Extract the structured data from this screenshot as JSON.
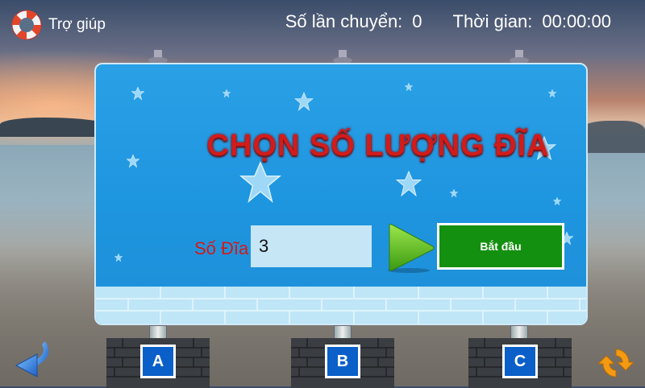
{
  "header": {
    "help_label": "Trợ giúp",
    "moves_label": "Số lần chuyển:",
    "moves_value": "0",
    "time_label": "Thời gian:",
    "time_value": "00:00:00"
  },
  "board": {
    "title": "CHỌN SỐ LƯỢNG ĐĨA",
    "disk_label": "Số Đĩa",
    "disk_value": "3",
    "start_label": "Bắt đầu"
  },
  "pegs": [
    {
      "label": "A"
    },
    {
      "label": "B"
    },
    {
      "label": "C"
    }
  ],
  "icons": {
    "help": "lifebuoy-icon",
    "play": "play-arrow-icon",
    "back": "back-arrow-icon",
    "reload": "refresh-icon"
  },
  "colors": {
    "board": "#1e95df",
    "title": "#d11c1c",
    "start_button": "#13900f",
    "peg_label": "#0a5fc9"
  }
}
